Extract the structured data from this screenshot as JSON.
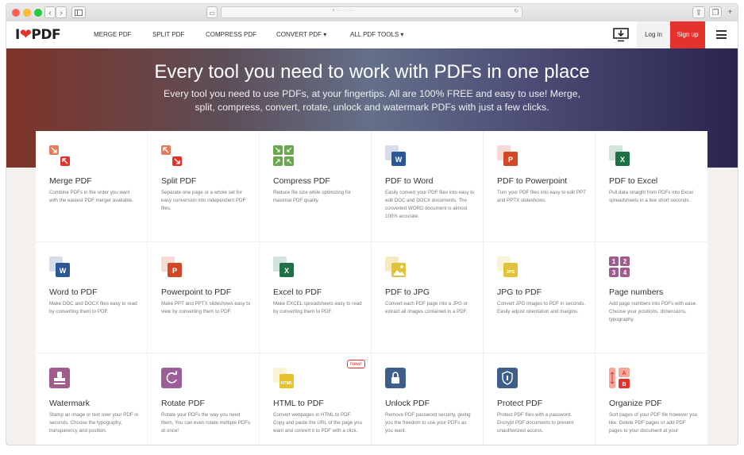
{
  "nav": {
    "logo_prefix": "I",
    "logo_suffix": "PDF",
    "links": [
      "MERGE PDF",
      "SPLIT PDF",
      "COMPRESS PDF",
      "CONVERT PDF ▾",
      "ALL PDF TOOLS ▾"
    ],
    "login": "Log in",
    "signup": "Sign up"
  },
  "hero": {
    "title": "Every tool you need to work with PDFs in one place",
    "subtitle": "Every tool you need to use PDFs, at your fingertips. All are 100% FREE and easy to use! Merge, split, compress, convert, rotate, unlock and watermark PDFs with just a few clicks."
  },
  "colors": {
    "brand": "#e5322d",
    "merge": "#e5322d",
    "compress": "#6aa84f",
    "word": "#2b5797",
    "powerpoint": "#d24726",
    "excel": "#1e7145",
    "jpg": "#e0c33a",
    "watermark": "#a05c8c",
    "rotate": "#9b5e99",
    "html": "#e7c02d",
    "unlock": "#3e5f8a",
    "protect": "#3e5f8a",
    "organize": "#e5322d",
    "pagenum": "#a05c8c"
  },
  "tools": [
    {
      "title": "Merge PDF",
      "desc": "Combine PDFs in the order you want with the easiest PDF merger available.",
      "icon": "merge-icon"
    },
    {
      "title": "Split PDF",
      "desc": "Separate one page or a whole set for easy conversion into independent PDF files.",
      "icon": "split-icon"
    },
    {
      "title": "Compress PDF",
      "desc": "Reduce file size while optimizing for maximal PDF quality.",
      "icon": "compress-icon"
    },
    {
      "title": "PDF to Word",
      "desc": "Easily convert your PDF files into easy to edit DOC and DOCX documents. The converted WORD document is almost 100% accurate.",
      "icon": "word-icon",
      "letter": "W"
    },
    {
      "title": "PDF to Powerpoint",
      "desc": "Turn your PDF files into easy to edit PPT and PPTX slideshows.",
      "icon": "powerpoint-icon",
      "letter": "P"
    },
    {
      "title": "PDF to Excel",
      "desc": "Pull data straight from PDFs into Excel spreadsheets in a few short seconds.",
      "icon": "excel-icon",
      "letter": "X"
    },
    {
      "title": "Word to PDF",
      "desc": "Make DOC and DOCX files easy to read by converting them to PDF.",
      "icon": "word-icon",
      "letter": "W"
    },
    {
      "title": "Powerpoint to PDF",
      "desc": "Make PPT and PPTX slideshows easy to view by converting them to PDF.",
      "icon": "powerpoint-icon",
      "letter": "P"
    },
    {
      "title": "Excel to PDF",
      "desc": "Make EXCEL spreadsheets easy to read by converting them to PDF.",
      "icon": "excel-icon",
      "letter": "X"
    },
    {
      "title": "PDF to JPG",
      "desc": "Convert each PDF page into a JPG or extract all images contained in a PDF.",
      "icon": "image-icon"
    },
    {
      "title": "JPG to PDF",
      "desc": "Convert JPG images to PDF in seconds. Easily adjust orientation and margins.",
      "icon": "jpg-icon",
      "letter": "JPG"
    },
    {
      "title": "Page numbers",
      "desc": "Add page numbers into PDFs with ease. Choose your positions, dimensions, typography.",
      "icon": "page-numbers-icon"
    },
    {
      "title": "Watermark",
      "desc": "Stamp an image or text over your PDF in seconds. Choose the typography, transparency and position.",
      "icon": "stamp-icon"
    },
    {
      "title": "Rotate PDF",
      "desc": "Rotate your PDFs the way you need them. You can even rotate multiple PDFs at once!",
      "icon": "rotate-icon"
    },
    {
      "title": "HTML to PDF",
      "desc": "Convert webpages in HTML to PDF. Copy and paste the URL of the page you want and convert it to PDF with a click.",
      "icon": "html-icon",
      "letter": "HTML",
      "badge": "New!"
    },
    {
      "title": "Unlock PDF",
      "desc": "Remove PDF password security, giving you the freedom to use your PDFs as you want.",
      "icon": "unlock-icon"
    },
    {
      "title": "Protect PDF",
      "desc": "Protect PDF files with a password. Encrypt PDF documents to prevent unauthorized access.",
      "icon": "shield-icon"
    },
    {
      "title": "Organize PDF",
      "desc": "Sort pages of your PDF file however you like. Delete PDF pages or add PDF pages to your document at your",
      "icon": "organize-icon"
    }
  ]
}
